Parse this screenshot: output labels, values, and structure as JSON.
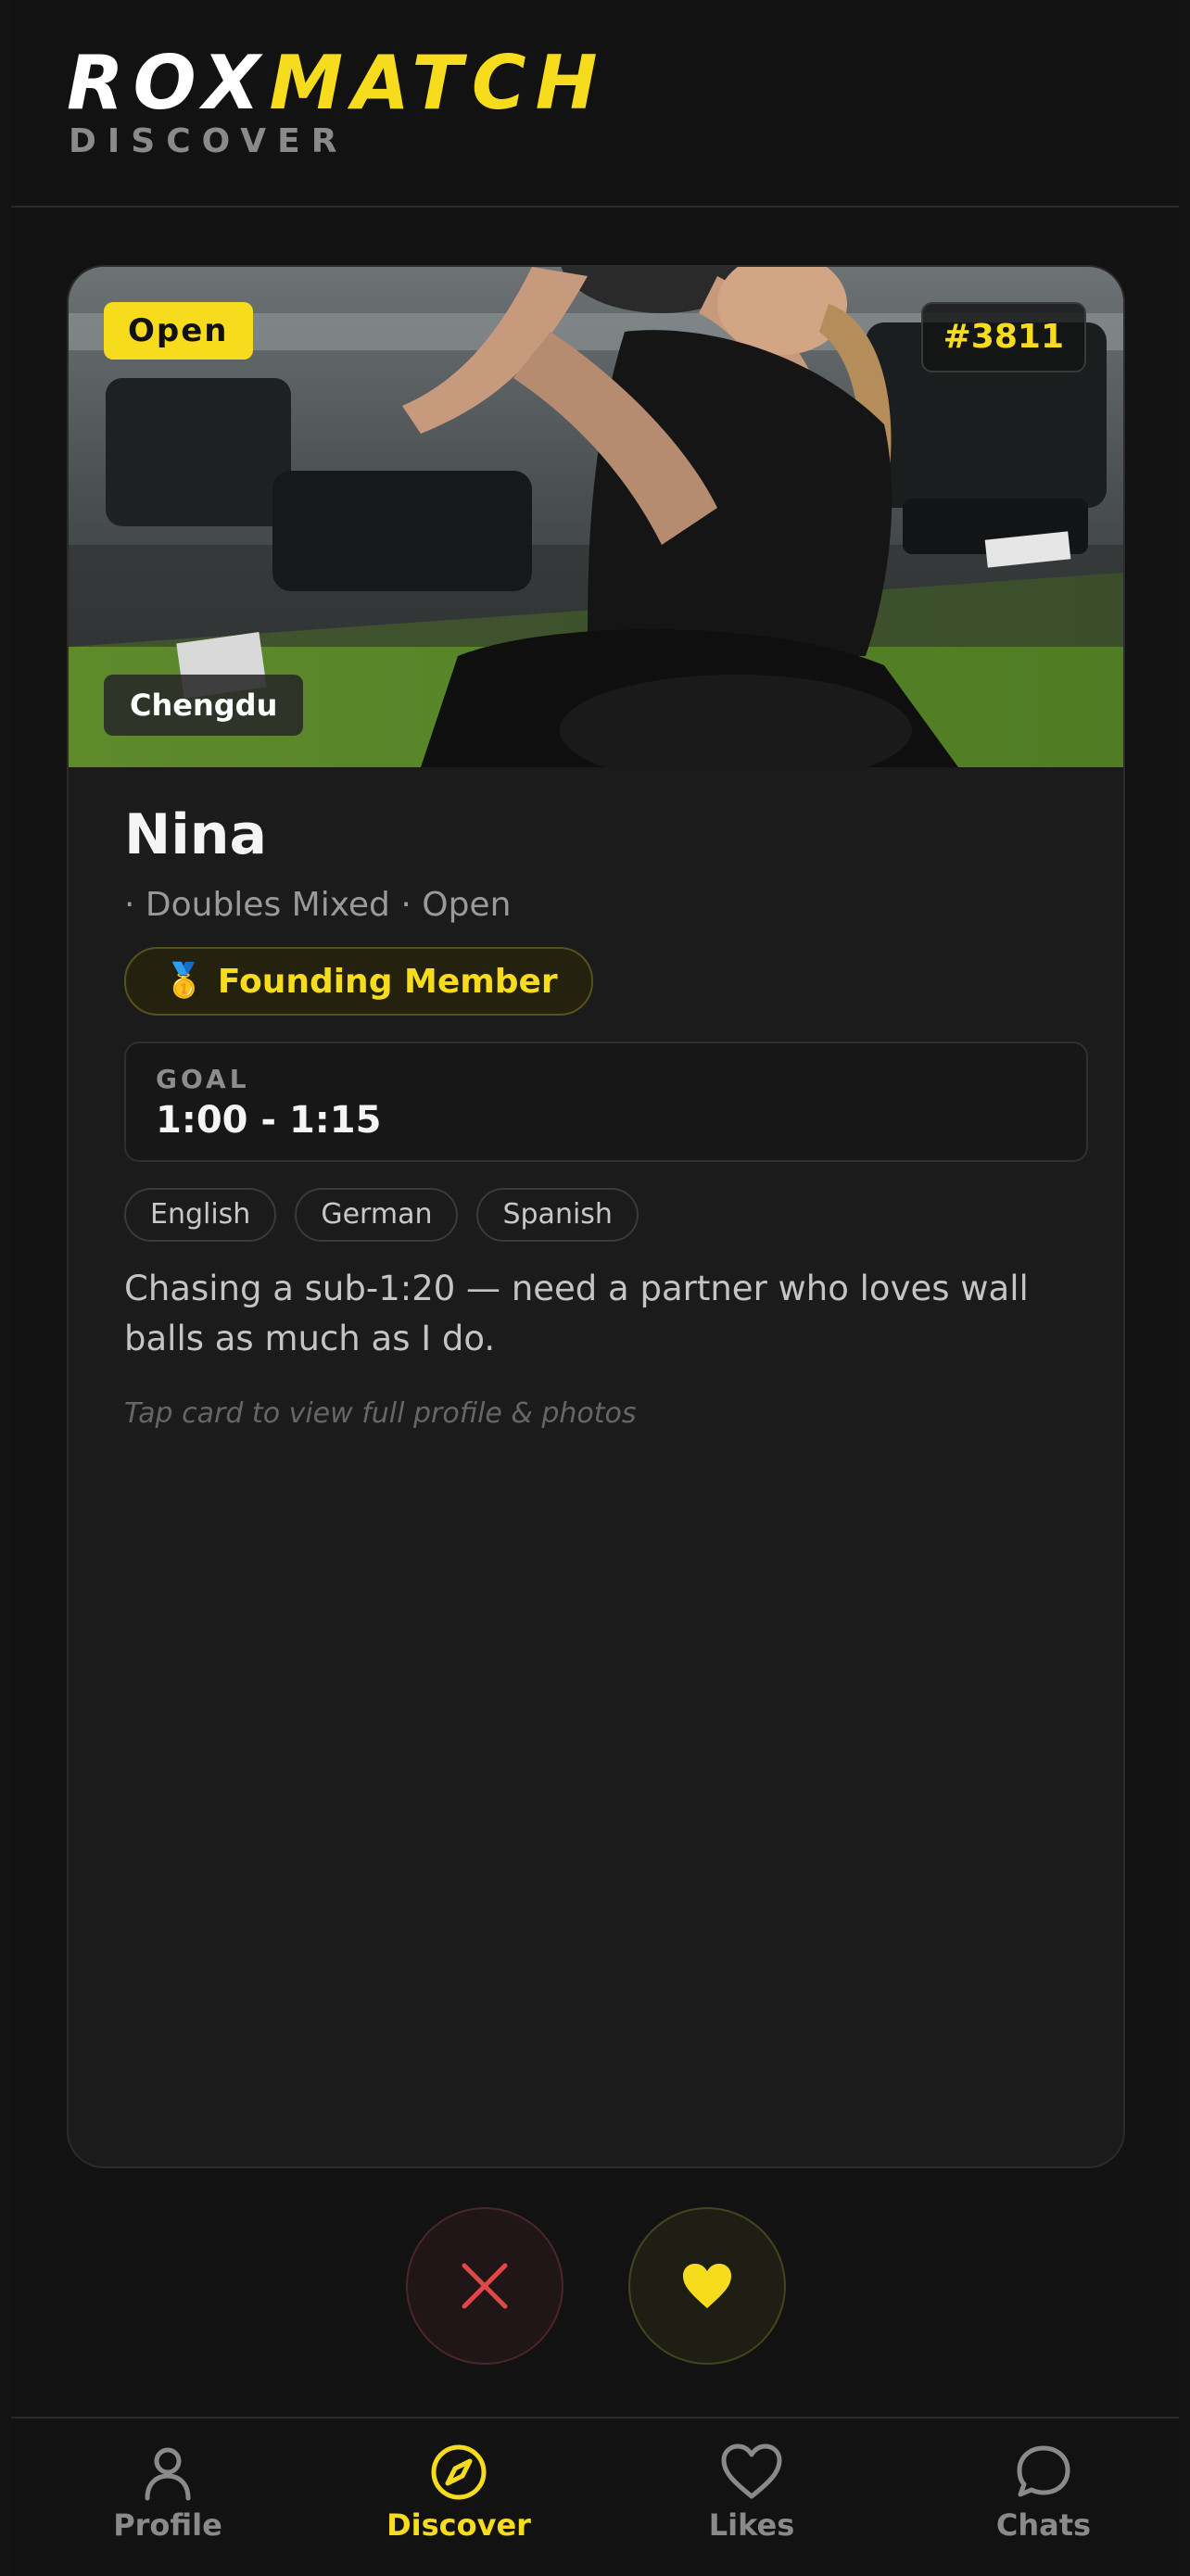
{
  "header": {
    "logo_part1": "ROX",
    "logo_part2": "MATCH",
    "section": "DISCOVER"
  },
  "card": {
    "status_badge": "Open",
    "profile_number": "#3811",
    "city": "Chengdu",
    "photo_description_icon": "profile-photo",
    "name": "Nina",
    "meta": "· Doubles Mixed · Open",
    "founding_badge": {
      "icon": "medal-icon",
      "label": "Founding Member"
    },
    "goal": {
      "label": "GOAL",
      "value": "1:00 - 1:15"
    },
    "languages": [
      "English",
      "German",
      "Spanish"
    ],
    "bio": "Chasing a sub-1:20 — need a partner who loves wall balls as much as I do.",
    "hint": "Tap card to view full profile & photos"
  },
  "actions": {
    "pass_icon": "close-icon",
    "like_icon": "heart-icon"
  },
  "nav": {
    "items": [
      {
        "label": "Profile",
        "icon": "person-icon",
        "active": false
      },
      {
        "label": "Discover",
        "icon": "compass-icon",
        "active": true
      },
      {
        "label": "Likes",
        "icon": "heart-icon",
        "active": false
      },
      {
        "label": "Chats",
        "icon": "chat-bubble-icon",
        "active": false
      }
    ]
  },
  "colors": {
    "accent": "#f7dc1e",
    "background": "#121212",
    "card": "#1b1b1b",
    "pass": "#e04848"
  }
}
